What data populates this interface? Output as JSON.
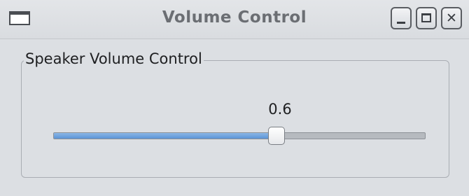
{
  "window": {
    "title": "Volume Control"
  },
  "titlebar_buttons": {
    "minimize_icon": "minimize-icon",
    "maximize_icon": "maximize-icon",
    "close_icon": "close-icon",
    "close_glyph": "✕"
  },
  "group": {
    "legend": "Speaker Volume Control"
  },
  "slider": {
    "value_label": "0.6",
    "value": 0.6,
    "min": 0,
    "max": 1
  },
  "colors": {
    "accent_fill": "#5b94d6",
    "window_bg": "#dcdfe3"
  }
}
